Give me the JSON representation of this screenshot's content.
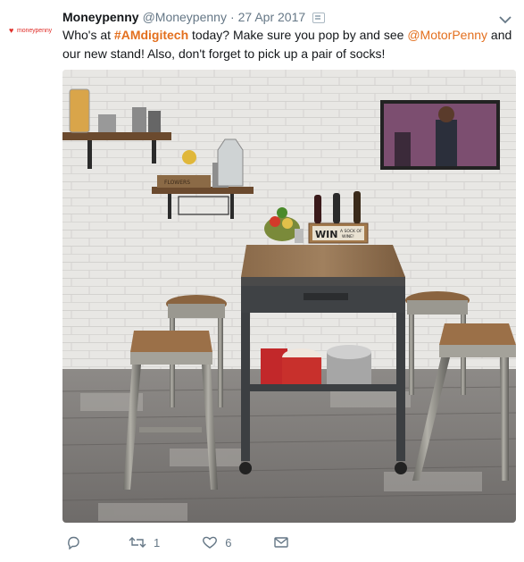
{
  "tweet": {
    "avatar": {
      "brand_text": "moneypenny",
      "icon": "heart-logo-icon",
      "color": "#e0302b"
    },
    "author": {
      "display_name": "Moneypenny",
      "handle": "@Moneypenny",
      "separator": "·",
      "date": "27 Apr 2017"
    },
    "text": {
      "part1": "Who's at ",
      "hashtag": "#AMdigitech",
      "part2": " today? Make sure you pop by and see ",
      "mention": "@MotorPenny",
      "part3": " and our new stand! Also, don't forget to pick up a pair of socks!"
    },
    "media": {
      "description_icon": "photo",
      "crate_sign": {
        "main": "WIN",
        "sub1": "A SOCK OF",
        "sub2": "WINE!"
      },
      "box_label": "FLOWERS"
    },
    "actions": {
      "reply": {
        "icon": "reply-icon",
        "count": ""
      },
      "retweet": {
        "icon": "retweet-icon",
        "count": "1"
      },
      "like": {
        "icon": "heart-icon",
        "count": "6"
      },
      "message": {
        "icon": "envelope-icon"
      }
    },
    "colors": {
      "link": "#e36f1e",
      "muted": "#657786",
      "text": "#14171a"
    }
  }
}
